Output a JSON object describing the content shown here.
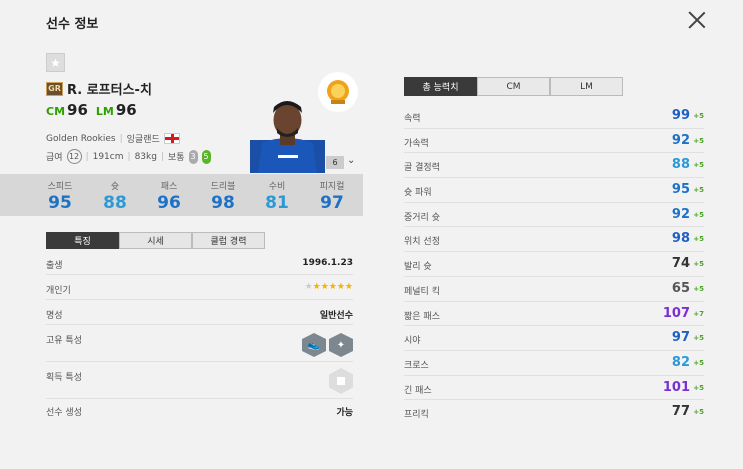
{
  "header": {
    "title": "선수 정보"
  },
  "player": {
    "season_badge": "GR",
    "name": "R. 로프터스-치",
    "positions": [
      {
        "pos": "CM",
        "ovr": "96"
      },
      {
        "pos": "LM",
        "ovr": "96"
      }
    ],
    "season_name": "Golden Rookies",
    "country": "잉글랜드",
    "salary_label": "급여",
    "salary": "12",
    "height": "191cm",
    "weight": "83kg",
    "body": "보통",
    "weak_foot": "3",
    "strong_foot": "5",
    "enhance": "6"
  },
  "summary_stats": [
    {
      "label": "스피드",
      "value": "95",
      "color": "#1d72c6"
    },
    {
      "label": "슛",
      "value": "88",
      "color": "#2b99d6"
    },
    {
      "label": "패스",
      "value": "96",
      "color": "#1d72c6"
    },
    {
      "label": "드리블",
      "value": "98",
      "color": "#1d72c6"
    },
    {
      "label": "수비",
      "value": "81",
      "color": "#2b99d6"
    },
    {
      "label": "피지컬",
      "value": "97",
      "color": "#1d72c6"
    }
  ],
  "left_tabs": [
    "특징",
    "시세",
    "클럽 경력"
  ],
  "details": {
    "birth_label": "출생",
    "birth": "1996.1.23",
    "popularity_label": "개인기",
    "fame_label": "명성",
    "fame": "일반선수",
    "unique_trait_label": "고유 특성",
    "acquired_trait_label": "획득 특성",
    "create_label": "선수 생성",
    "create": "가능"
  },
  "right_tabs": [
    "총 능력치",
    "CM",
    "LM"
  ],
  "attributes": [
    {
      "label": "속력",
      "value": "99",
      "bonus": "+5",
      "color": "#1d5fc6"
    },
    {
      "label": "가속력",
      "value": "92",
      "bonus": "+5",
      "color": "#1d72c6"
    },
    {
      "label": "골 결정력",
      "value": "88",
      "bonus": "+5",
      "color": "#2b99d6"
    },
    {
      "label": "슛 파워",
      "value": "95",
      "color": "#1d72c6",
      "bonus": "+5"
    },
    {
      "label": "중거리 슛",
      "value": "92",
      "bonus": "+5",
      "color": "#1d72c6"
    },
    {
      "label": "위치 선정",
      "value": "98",
      "bonus": "+5",
      "color": "#1d5fc6"
    },
    {
      "label": "발리 슛",
      "value": "74",
      "bonus": "+5",
      "color": "#333333"
    },
    {
      "label": "페널티 킥",
      "value": "65",
      "bonus": "+5",
      "color": "#555555"
    },
    {
      "label": "짧은 패스",
      "value": "107",
      "bonus": "+7",
      "color": "#7b2fd0"
    },
    {
      "label": "시야",
      "value": "97",
      "bonus": "+5",
      "color": "#1d5fc6"
    },
    {
      "label": "크로스",
      "value": "82",
      "bonus": "+5",
      "color": "#2b99d6"
    },
    {
      "label": "긴 패스",
      "value": "101",
      "bonus": "+5",
      "color": "#7b2fd0"
    },
    {
      "label": "프리킥",
      "value": "77",
      "bonus": "+5",
      "color": "#333333"
    }
  ]
}
